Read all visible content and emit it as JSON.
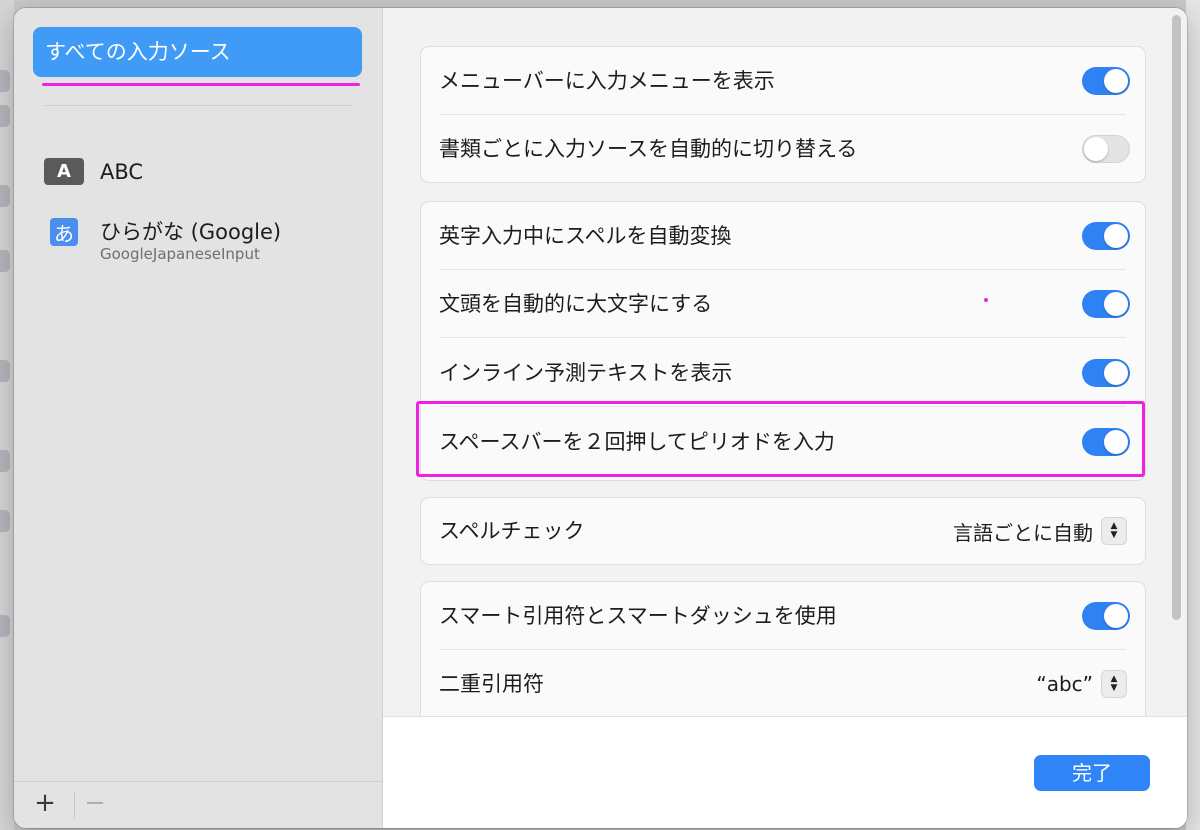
{
  "sidebar": {
    "selected_item": "すべての入力ソース",
    "sources": [
      {
        "icon_text": "A",
        "icon": "abc-input-icon",
        "title": "ABC",
        "subtitle": ""
      },
      {
        "icon_text": "あ",
        "icon": "hiragana-input-icon",
        "title": "ひらがな (Google)",
        "subtitle": "GoogleJapaneseInput"
      }
    ],
    "footer": {
      "add_label": "+",
      "remove_label": "−"
    }
  },
  "settings": {
    "group1": [
      {
        "label": "メニューバーに入力メニューを表示",
        "toggle": "on"
      },
      {
        "label": "書類ごとに入力ソースを自動的に切り替える",
        "toggle": "off"
      }
    ],
    "group2": [
      {
        "label": "英字入力中にスペルを自動変換",
        "toggle": "on"
      },
      {
        "label": "文頭を自動的に大文字にする",
        "toggle": "on"
      },
      {
        "label": "インライン予測テキストを表示",
        "toggle": "on"
      },
      {
        "label": "スペースバーを２回押してピリオドを入力",
        "toggle": "on"
      }
    ],
    "group3": [
      {
        "label": "スペルチェック",
        "value": "言語ごとに自動"
      }
    ],
    "group4": [
      {
        "label": "スマート引用符とスマートダッシュを使用",
        "toggle": "on"
      },
      {
        "label": "二重引用符",
        "value": "“abc”"
      }
    ]
  },
  "footer": {
    "done_label": "完了"
  },
  "colors": {
    "accent": "#2f82f3",
    "highlight": "#f020e4",
    "sidebar_selected": "#3f9bf6"
  }
}
